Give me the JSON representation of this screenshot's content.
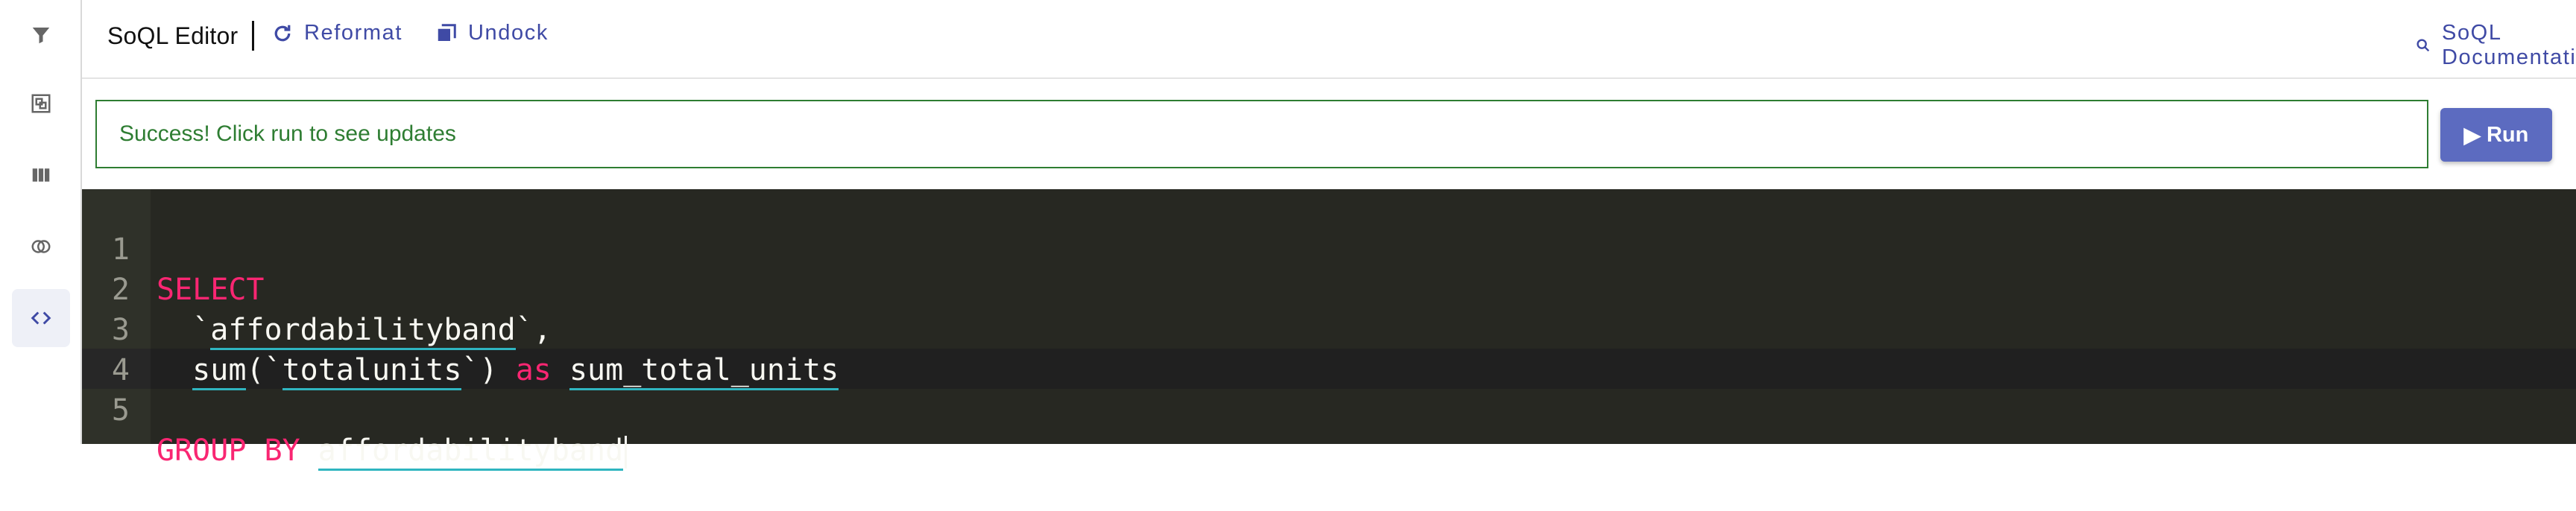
{
  "sidebar": {
    "items": [
      {
        "icon": "filter-icon"
      },
      {
        "icon": "group-icon"
      },
      {
        "icon": "columns-icon"
      },
      {
        "icon": "join-icon"
      },
      {
        "icon": "code-icon",
        "active": true
      }
    ]
  },
  "header": {
    "title": "SoQL Editor",
    "reformat_label": "Reformat",
    "undock_label": "Undock",
    "docs_label": "SoQL Documentation"
  },
  "status": {
    "message": "Success! Click run to see updates",
    "color": "#2e7d32"
  },
  "run_button": {
    "label": "Run"
  },
  "editor": {
    "line_numbers": [
      "1",
      "2",
      "3",
      "4",
      "5"
    ],
    "tokens": {
      "select": "SELECT",
      "tick_open_1": "`",
      "field_1": "affordabilityband",
      "tick_close_1": "`,",
      "sum_fn": "sum",
      "paren_open": "(`",
      "field_2": "totalunits",
      "paren_close": "`)",
      "as_kw": "as",
      "alias": "sum_total_units",
      "group_by": "GROUP BY",
      "group_field": "affordabilityband"
    },
    "colors": {
      "background": "#272822",
      "keyword": "#f92672",
      "identifier_underline": "#2fb5c0"
    }
  }
}
